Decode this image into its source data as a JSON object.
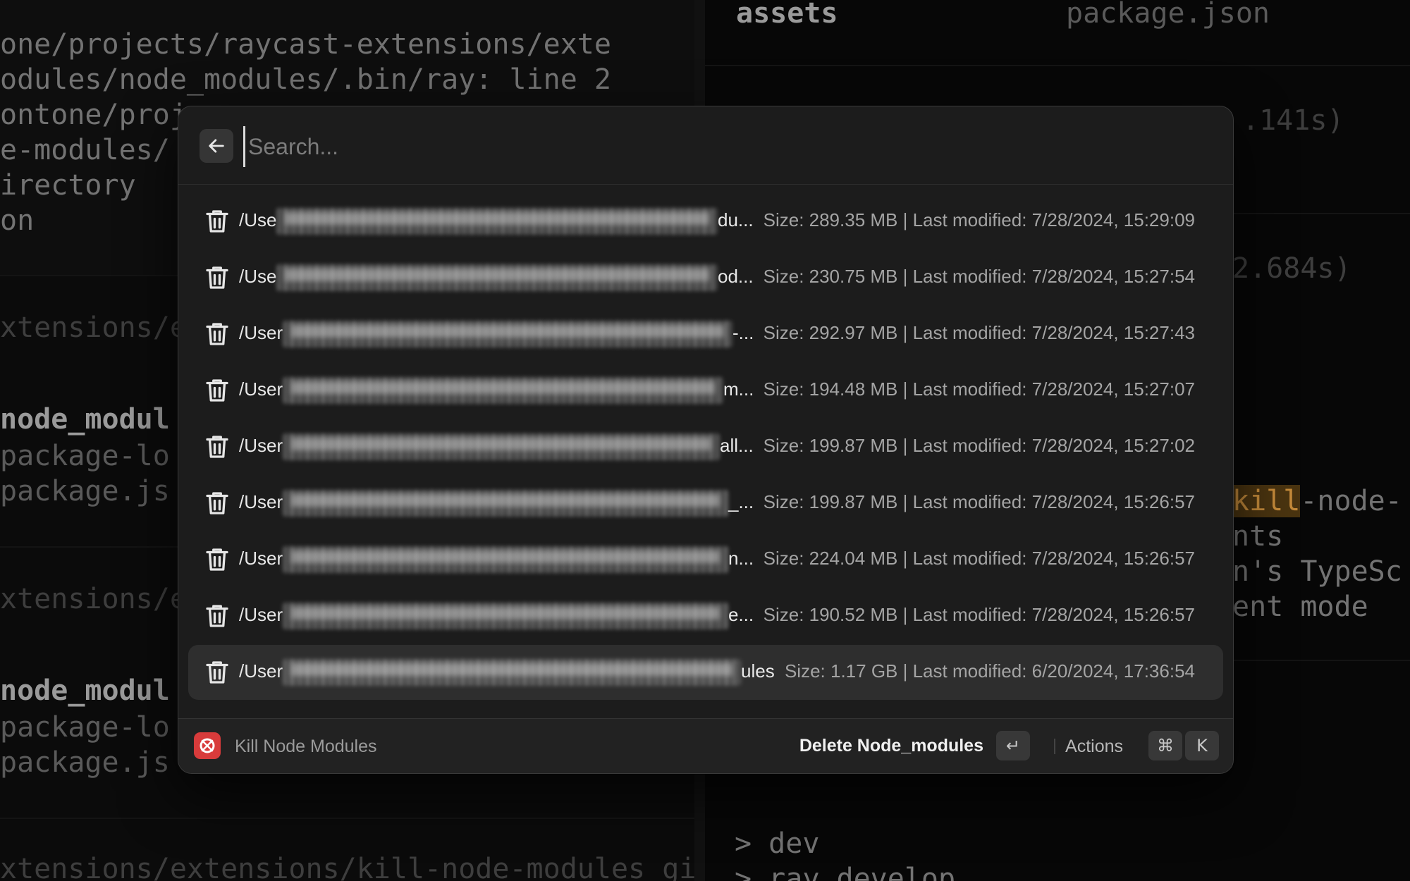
{
  "terminal_left": {
    "lines_top": [
      "one/projects/raycast-extensions/exte",
      "odules/node_modules/.bin/ray: line 2",
      "ontone/proj",
      "e-modules/",
      "irectory",
      "on"
    ],
    "prompt_1": "xtensions/ex",
    "block_1": [
      "node_modul",
      "package-lo",
      "package.js"
    ],
    "prompt_2": "xtensions/ex",
    "block_2": [
      "node_modul",
      "package-lo",
      "package.js"
    ],
    "prompt_3": "xtensions/extensions/kill-node-modules git:("
  },
  "terminal_right": {
    "header_left": "assets",
    "header_right": "package.json",
    "timing_1": ".141s)",
    "timing_2": "2.684s)",
    "hl_word": "kill",
    "lines_after_hl": "-node-",
    "line_2": "nts",
    "line_3": "n's TypeSc",
    "line_4": "ent mode",
    "cmd_1": "> dev",
    "cmd_2": "> ray develop"
  },
  "search": {
    "placeholder": "Search..."
  },
  "rows": [
    {
      "path_start": "/Use",
      "path_end": "du...",
      "meta": "Size: 289.35 MB | Last modified: 7/28/2024, 15:29:09"
    },
    {
      "path_start": "/Use",
      "path_end": "od...",
      "meta": "Size: 230.75 MB | Last modified: 7/28/2024, 15:27:54"
    },
    {
      "path_start": "/User",
      "path_end": "-...",
      "meta": "Size: 292.97 MB | Last modified: 7/28/2024, 15:27:43"
    },
    {
      "path_start": "/User",
      "path_end": "m...",
      "meta": "Size: 194.48 MB | Last modified: 7/28/2024, 15:27:07"
    },
    {
      "path_start": "/User",
      "path_end": "all...",
      "meta": "Size: 199.87 MB | Last modified: 7/28/2024, 15:27:02"
    },
    {
      "path_start": "/User",
      "path_end": "_...",
      "meta": "Size: 199.87 MB | Last modified: 7/28/2024, 15:26:57"
    },
    {
      "path_start": "/User",
      "path_end": "n...",
      "meta": "Size: 224.04 MB | Last modified: 7/28/2024, 15:26:57"
    },
    {
      "path_start": "/User",
      "path_end": "e...",
      "meta": "Size: 190.52 MB | Last modified: 7/28/2024, 15:26:57"
    },
    {
      "path_start": "/User",
      "path_end": "ules",
      "meta": "Size: 1.17 GB | Last modified: 6/20/2024, 17:36:54"
    }
  ],
  "footer": {
    "app_name": "Kill Node Modules",
    "primary_action": "Delete Node_modules",
    "enter_key": "↵",
    "actions_label": "Actions",
    "cmd_key": "⌘",
    "k_key": "K"
  },
  "colors": {
    "dialog_bg": "#1c1c1c",
    "selected_row": "#2e2e2e",
    "app_icon": "#d83b3b"
  },
  "icons": {
    "back": "arrow-left-icon",
    "row": "trash-icon",
    "app": "kill-node-modules-app-icon"
  }
}
